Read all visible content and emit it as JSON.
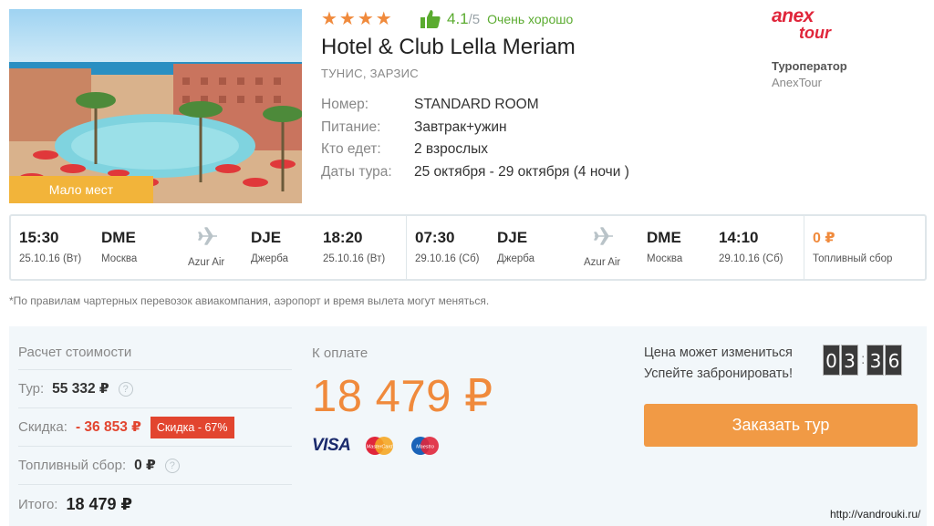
{
  "hotel": {
    "badge": "Мало мест",
    "stars": "★★★★",
    "rating_value": "4.1",
    "rating_of": "/5",
    "rating_text": "Очень хорошо",
    "name": "Hotel & Club Lella Meriam",
    "location": "ТУНИС, ЗАРЗИС",
    "details": [
      {
        "label": "Номер:",
        "value": "STANDARD ROOM"
      },
      {
        "label": "Питание:",
        "value": "Завтрак+ужин"
      },
      {
        "label": "Кто едет:",
        "value": "2 взрослых"
      },
      {
        "label": "Даты тура:",
        "value": "25 октября - 29 октября (4 ночи )"
      }
    ]
  },
  "operator": {
    "logo_top": "anex",
    "logo_bottom": "tour",
    "label": "Туроператор",
    "name": "AnexTour"
  },
  "flights": {
    "outbound": {
      "depart_time": "15:30",
      "depart_date": "25.10.16 (Вт)",
      "from_code": "DME",
      "from_city": "Москва",
      "airline": "Azur Air",
      "to_code": "DJE",
      "to_city": "Джерба",
      "arrive_time": "18:20",
      "arrive_date": "25.10.16 (Вт)"
    },
    "return": {
      "depart_time": "07:30",
      "depart_date": "29.10.16 (Сб)",
      "from_code": "DJE",
      "from_city": "Джерба",
      "airline": "Azur Air",
      "to_code": "DME",
      "to_city": "Москва",
      "arrive_time": "14:10",
      "arrive_date": "29.10.16 (Сб)"
    },
    "fuel_fee": "0 ₽",
    "fuel_fee_label": "Топливный сбор"
  },
  "note": "*По правилам чартерных перевозок авиакомпания, аэропорт и время вылета могут меняться.",
  "price": {
    "calc_title": "Расчет стоимости",
    "tour_label": "Тур:",
    "tour_value": "55 332 ₽",
    "discount_label": "Скидка:",
    "discount_value": "- 36 853 ₽",
    "discount_badge": "Скидка - 67%",
    "fuel_label": "Топливный сбор:",
    "fuel_value": "0 ₽",
    "total_label": "Итого:",
    "total_value": "18 479 ₽",
    "pay_label": "К оплате",
    "pay_amount": "18 479 ₽",
    "cards": [
      "VISA",
      "MasterCard",
      "Maestro"
    ],
    "change_note_1": "Цена может измениться",
    "change_note_2": "Успейте забронировать!",
    "timer": [
      "0",
      "3",
      "3",
      "6"
    ],
    "order_button": "Заказать тур"
  },
  "watermark": "http://vandrouki.ru/",
  "colors": {
    "accent": "#f08a3c",
    "button": "#f19a45",
    "discount": "#e2452f",
    "rating": "#5aab2f"
  }
}
